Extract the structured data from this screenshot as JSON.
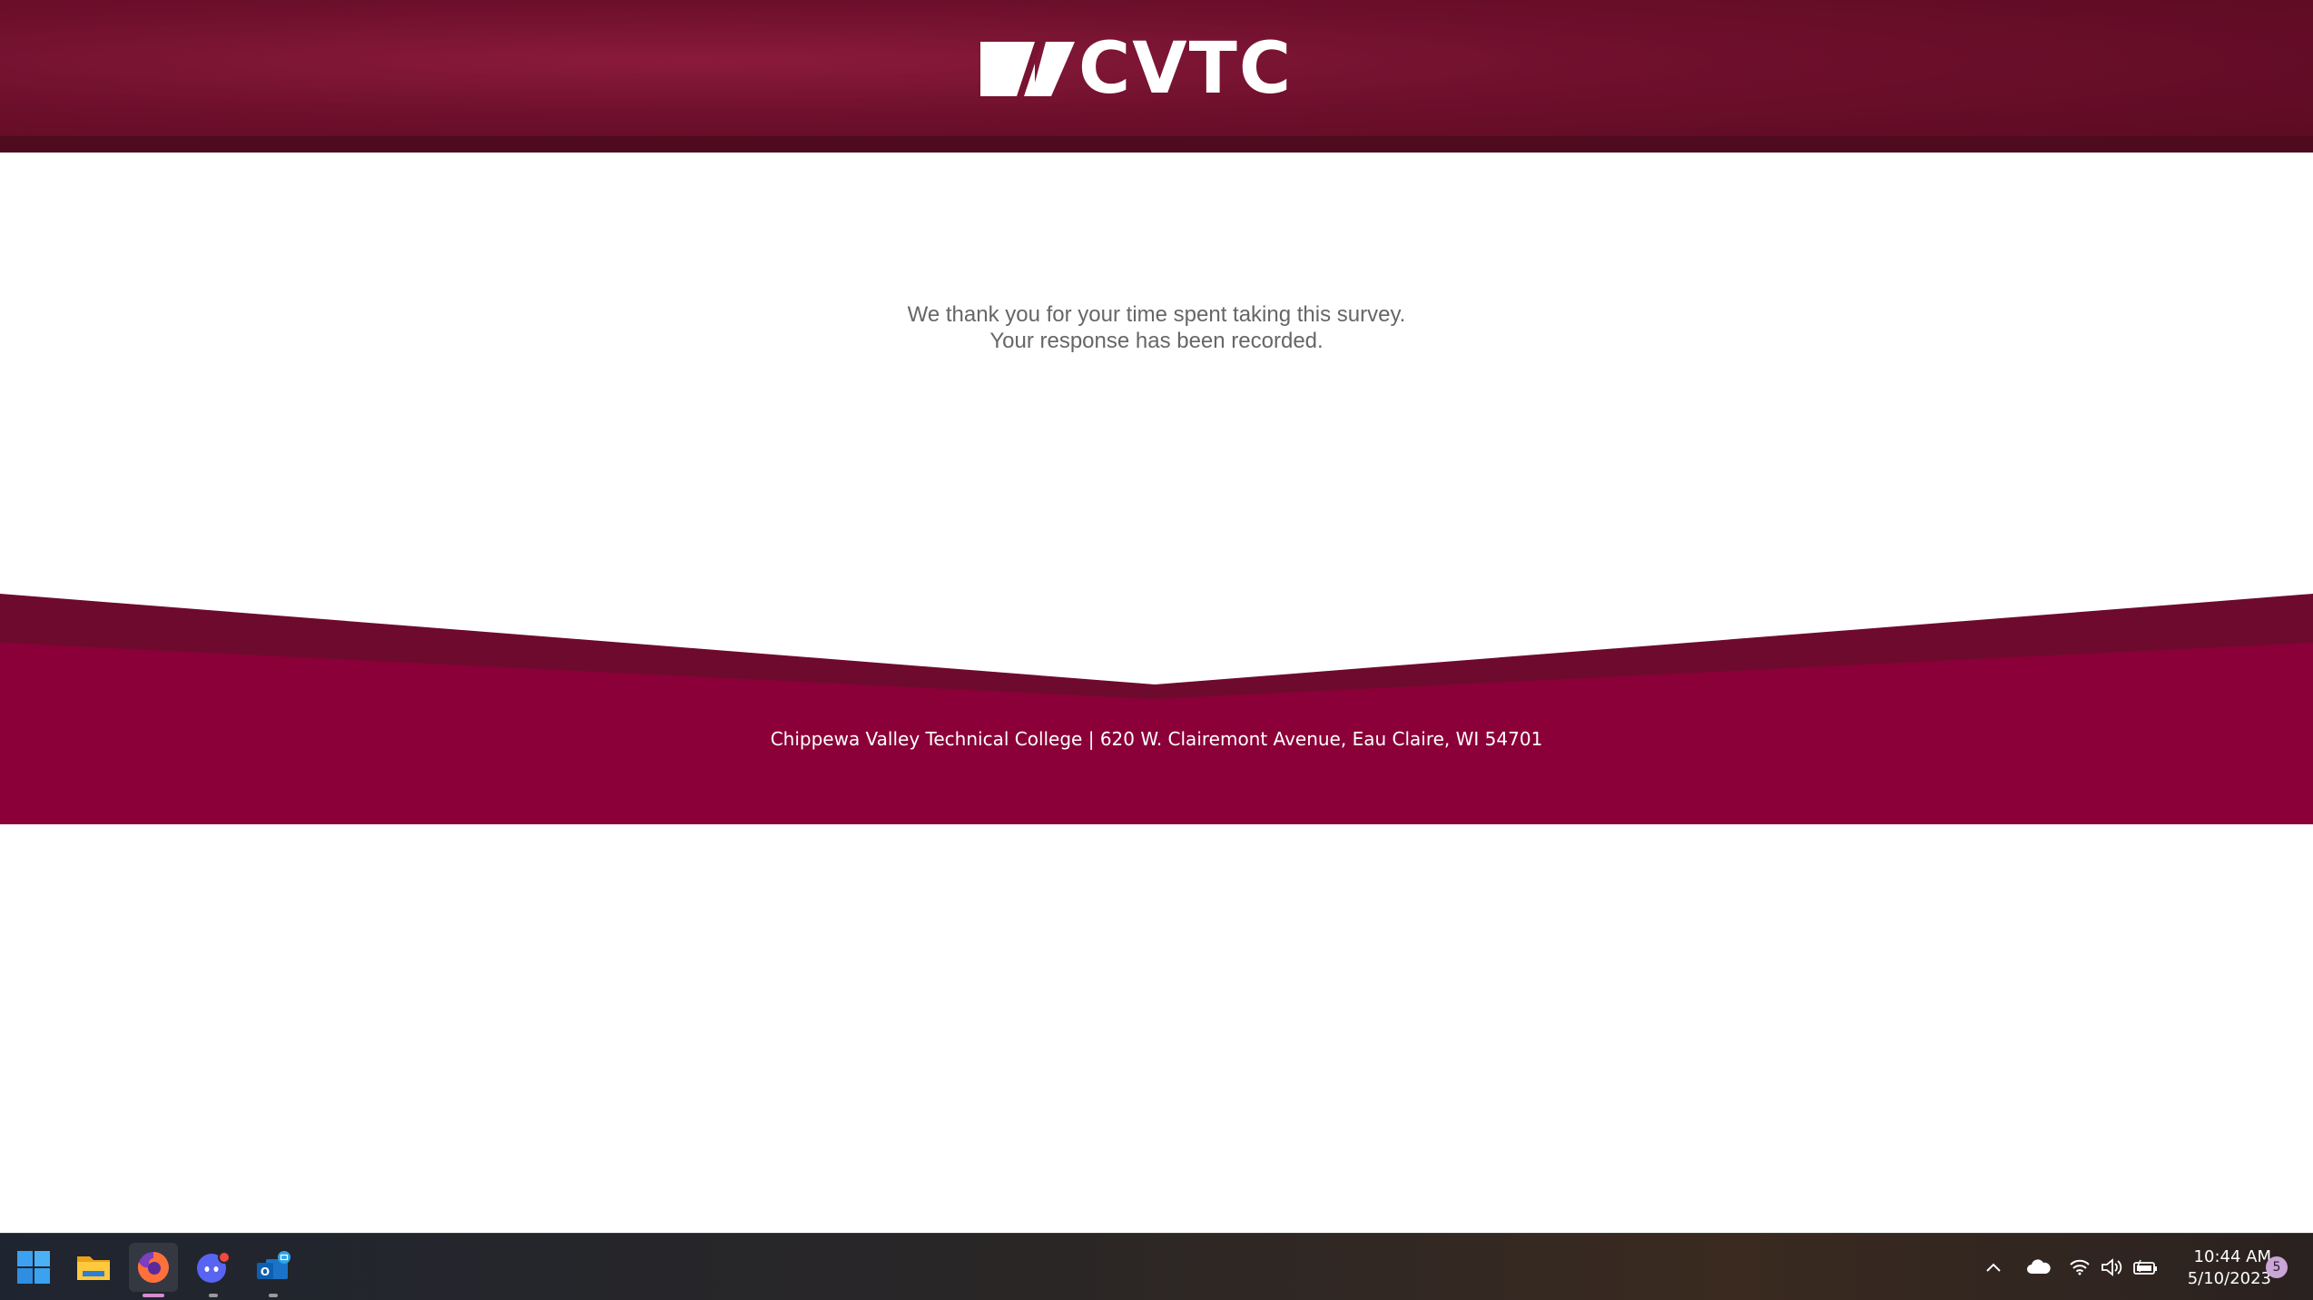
{
  "header": {
    "logo_text": "CVTC",
    "brand_color": "#6d0f2c"
  },
  "main": {
    "line1": "We thank you for your time spent taking this survey.",
    "line2": "Your response has been recorded."
  },
  "footer": {
    "address": "Chippewa Valley Technical College | 620 W. Clairemont Avenue, Eau Claire, WI 54701",
    "color": "#8b0038"
  },
  "taskbar": {
    "apps": [
      {
        "name": "start-icon"
      },
      {
        "name": "file-explorer-icon"
      },
      {
        "name": "firefox-icon",
        "active": true
      },
      {
        "name": "discord-icon"
      },
      {
        "name": "outlook-icon"
      }
    ],
    "tray_icons": [
      "chevron-up-icon",
      "onedrive-cloud-icon",
      "wifi-icon",
      "volume-icon",
      "battery-icon"
    ],
    "time": "10:44 AM",
    "date": "5/10/2023",
    "notification_count": "5"
  }
}
